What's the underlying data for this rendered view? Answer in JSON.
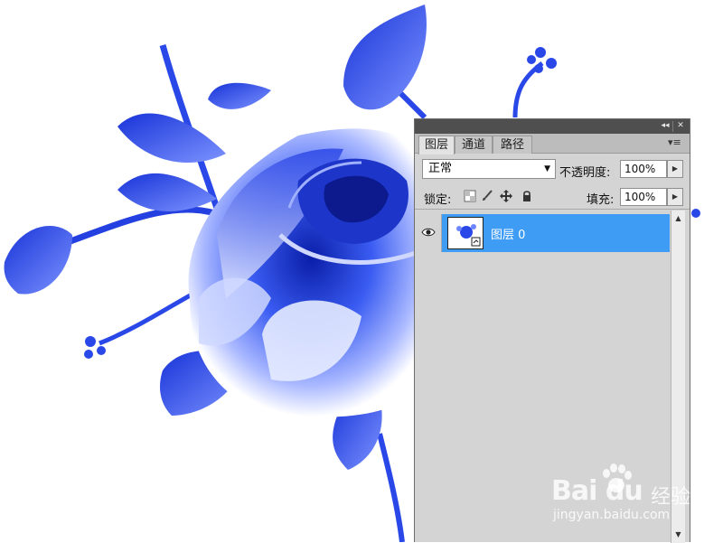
{
  "panel": {
    "collapse_glyph": "◂◂",
    "close_glyph": "✕",
    "menu_glyph": "▾≡",
    "tabs": [
      {
        "label": "图层",
        "active": true
      },
      {
        "label": "通道",
        "active": false
      },
      {
        "label": "路径",
        "active": false
      }
    ],
    "blend_mode": "正常",
    "opacity_label": "不透明度:",
    "opacity_value": "100%",
    "lock_label": "锁定:",
    "fill_label": "填充:",
    "fill_value": "100%",
    "layers": [
      {
        "name": "图层 0",
        "visible": true,
        "selected": true
      }
    ],
    "icons": [
      "eye-icon",
      "lock-transparent-icon",
      "brush-icon",
      "move-icon",
      "lock-icon",
      "dropdown-arrow-icon",
      "spin-arrow-icon"
    ]
  },
  "watermark": {
    "logo_text": "Bai du",
    "sub_text": "经验",
    "url": "jingyan.baidu.com"
  },
  "colors": {
    "selection": "#3e9cf5",
    "panel_bg": "#d4d4d4",
    "titlebar": "#4f4f4f",
    "rose_blue": "#1f3fe0"
  }
}
